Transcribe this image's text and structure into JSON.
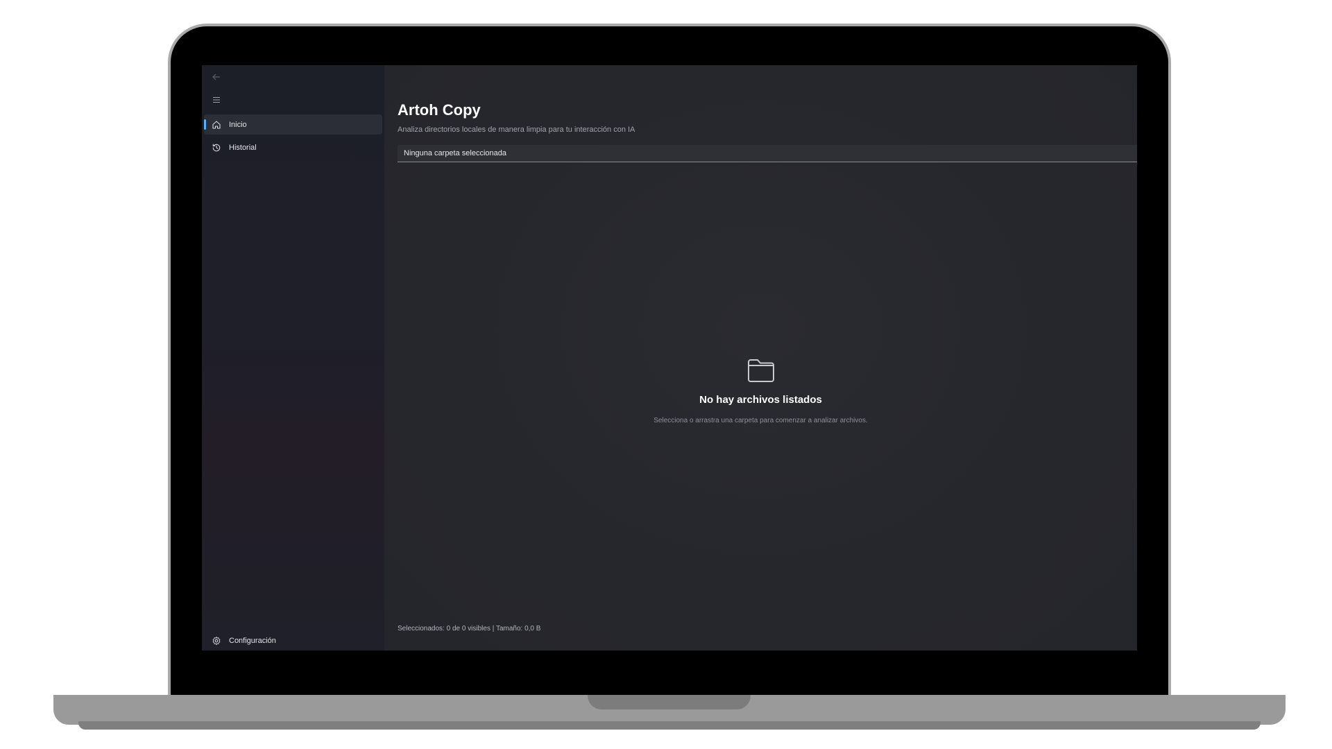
{
  "sidebar": {
    "items": [
      {
        "label": "Inicio",
        "icon": "home-icon",
        "active": true
      },
      {
        "label": "Historial",
        "icon": "history-icon",
        "active": false
      }
    ],
    "footer": {
      "label": "Configuración",
      "icon": "gear-icon"
    }
  },
  "main": {
    "title": "Artoh Copy",
    "subtitle": "Analiza directorios locales de manera limpia para tu interacción con IA",
    "folder_field": {
      "value": "Ninguna carpeta seleccionada"
    },
    "empty_state": {
      "icon": "folder-icon",
      "title": "No hay archivos listados",
      "text": "Selecciona o arrastra una carpeta para comenzar a analizar archivos."
    },
    "status": "Seleccionados: 0 de 0 visibles | Tamaño: 0,0 B"
  },
  "colors": {
    "accent": "#4fb3ff",
    "sidebar_bg": "#1e1f29",
    "main_bg": "#26272c"
  }
}
